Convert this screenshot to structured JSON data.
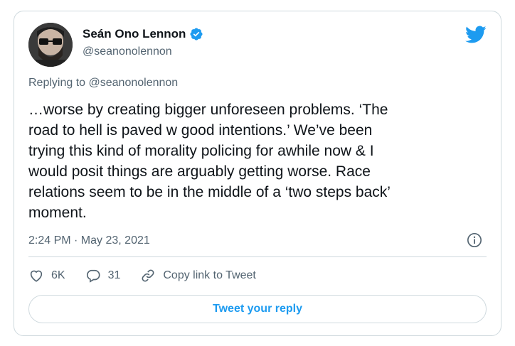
{
  "user": {
    "display_name": "Seán Ono Lennon",
    "handle": "@seanonolennon",
    "avatar": "avatar-photo",
    "verified_icon": "verified-badge-icon"
  },
  "brand": {
    "icon": "twitter-bird-icon",
    "color": "#1d9bf0"
  },
  "reply_context": {
    "prefix": "Replying to",
    "mention": "@seanonolennon"
  },
  "tweet": {
    "text": "…worse by creating bigger unforeseen problems. ‘The\nroad to hell is paved w good intentions.’ We’ve been\ntrying this kind of morality policing for awhile now & I\nwould posit things are arguably getting worse. Race\nrelations seem to be in the middle of a ‘two steps back’\nmoment.",
    "timestamp": "2:24 PM · May 23, 2021"
  },
  "actions": {
    "like_count": "6K",
    "reply_count": "31",
    "copy_link_label": "Copy link to Tweet"
  },
  "reply_button": {
    "label": "Tweet your reply"
  },
  "colors": {
    "text": "#0f1419",
    "secondary": "#536471",
    "border": "#cfd9de",
    "accent": "#1d9bf0"
  }
}
